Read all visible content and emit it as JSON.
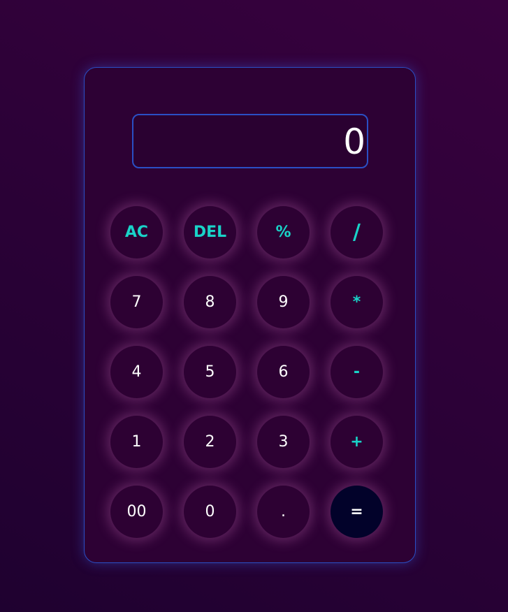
{
  "display": {
    "value": "0"
  },
  "keys": [
    {
      "label": "AC",
      "kind": "op",
      "name": "clear-button"
    },
    {
      "label": "DEL",
      "kind": "op",
      "name": "delete-button"
    },
    {
      "label": "%",
      "kind": "op",
      "name": "percent-button"
    },
    {
      "label": "/",
      "kind": "op slash",
      "name": "divide-button"
    },
    {
      "label": "7",
      "kind": "num",
      "name": "digit-7-button"
    },
    {
      "label": "8",
      "kind": "num",
      "name": "digit-8-button"
    },
    {
      "label": "9",
      "kind": "num",
      "name": "digit-9-button"
    },
    {
      "label": "*",
      "kind": "op",
      "name": "multiply-button"
    },
    {
      "label": "4",
      "kind": "num",
      "name": "digit-4-button"
    },
    {
      "label": "5",
      "kind": "num",
      "name": "digit-5-button"
    },
    {
      "label": "6",
      "kind": "num",
      "name": "digit-6-button"
    },
    {
      "label": "-",
      "kind": "op",
      "name": "subtract-button"
    },
    {
      "label": "1",
      "kind": "num",
      "name": "digit-1-button"
    },
    {
      "label": "2",
      "kind": "num",
      "name": "digit-2-button"
    },
    {
      "label": "3",
      "kind": "num",
      "name": "digit-3-button"
    },
    {
      "label": "+",
      "kind": "op",
      "name": "add-button"
    },
    {
      "label": "00",
      "kind": "num",
      "name": "double-zero-button"
    },
    {
      "label": "0",
      "kind": "num",
      "name": "digit-0-button"
    },
    {
      "label": ".",
      "kind": "num",
      "name": "decimal-point-button"
    },
    {
      "label": "=",
      "kind": "equals",
      "name": "equals-button"
    }
  ],
  "colors": {
    "accent": "#19d3c8",
    "border": "#2a4fc4",
    "equals_bg": "#02022a"
  }
}
